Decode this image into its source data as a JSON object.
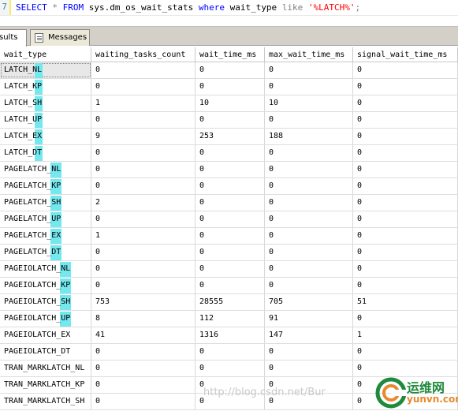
{
  "editor": {
    "line_number": "7",
    "tokens": {
      "select": "SELECT",
      "star": "*",
      "from": "FROM",
      "object": "sys.dm_os_wait_stats",
      "where": "where",
      "column": "wait_type",
      "like": "like",
      "pattern": "'%LATCH%'",
      "semicolon": ";"
    }
  },
  "tabs": {
    "results": "sults",
    "messages": "Messages"
  },
  "grid": {
    "columns": [
      "wait_type",
      "waiting_tasks_count",
      "wait_time_ms",
      "max_wait_time_ms",
      "signal_wait_time_ms"
    ],
    "rows": [
      [
        "LATCH_NL",
        "0",
        "0",
        "0",
        "0"
      ],
      [
        "LATCH_KP",
        "0",
        "0",
        "0",
        "0"
      ],
      [
        "LATCH_SH",
        "1",
        "10",
        "10",
        "0"
      ],
      [
        "LATCH_UP",
        "0",
        "0",
        "0",
        "0"
      ],
      [
        "LATCH_EX",
        "9",
        "253",
        "188",
        "0"
      ],
      [
        "LATCH_DT",
        "0",
        "0",
        "0",
        "0"
      ],
      [
        "PAGELATCH_NL",
        "0",
        "0",
        "0",
        "0"
      ],
      [
        "PAGELATCH_KP",
        "0",
        "0",
        "0",
        "0"
      ],
      [
        "PAGELATCH_SH",
        "2",
        "0",
        "0",
        "0"
      ],
      [
        "PAGELATCH_UP",
        "0",
        "0",
        "0",
        "0"
      ],
      [
        "PAGELATCH_EX",
        "1",
        "0",
        "0",
        "0"
      ],
      [
        "PAGELATCH_DT",
        "0",
        "0",
        "0",
        "0"
      ],
      [
        "PAGEIOLATCH_NL",
        "0",
        "0",
        "0",
        "0"
      ],
      [
        "PAGEIOLATCH_KP",
        "0",
        "0",
        "0",
        "0"
      ],
      [
        "PAGEIOLATCH_SH",
        "753",
        "28555",
        "705",
        "51"
      ],
      [
        "PAGEIOLATCH_UP",
        "8",
        "112",
        "91",
        "0"
      ],
      [
        "PAGEIOLATCH_EX",
        "41",
        "1316",
        "147",
        "1"
      ],
      [
        "PAGEIOLATCH_DT",
        "0",
        "0",
        "0",
        "0"
      ],
      [
        "TRAN_MARKLATCH_NL",
        "0",
        "0",
        "0",
        "0"
      ],
      [
        "TRAN_MARKLATCH_KP",
        "0",
        "0",
        "0",
        "0"
      ],
      [
        "TRAN_MARKLATCH_SH",
        "0",
        "0",
        "0",
        "0"
      ]
    ],
    "highlight_color": "#73e8ee"
  },
  "watermark": {
    "url": "http://blog.csdn.net/Bur",
    "brand": "运维网",
    "domain": "yunvn.com",
    "brand_color": "#1f8a3c",
    "domain_color": "#e68a2e"
  }
}
